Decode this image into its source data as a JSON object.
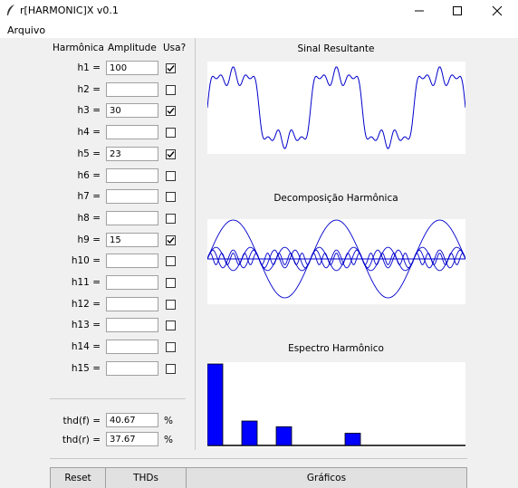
{
  "window": {
    "title": "r[HARMONIC]X v0.1"
  },
  "menu": {
    "file_label": "Arquivo"
  },
  "table": {
    "col_harmonic": "Harmônica",
    "col_amplitude": "Amplitude",
    "col_use": "Usa?",
    "rows": [
      {
        "label": "h1 =",
        "value": "100",
        "checked": true
      },
      {
        "label": "h2 =",
        "value": "",
        "checked": false
      },
      {
        "label": "h3 =",
        "value": "30",
        "checked": true
      },
      {
        "label": "h4 =",
        "value": "",
        "checked": false
      },
      {
        "label": "h5 =",
        "value": "23",
        "checked": true
      },
      {
        "label": "h6 =",
        "value": "",
        "checked": false
      },
      {
        "label": "h7 =",
        "value": "",
        "checked": false
      },
      {
        "label": "h8 =",
        "value": "",
        "checked": false
      },
      {
        "label": "h9 =",
        "value": "15",
        "checked": true
      },
      {
        "label": "h10 =",
        "value": "",
        "checked": false
      },
      {
        "label": "h11 =",
        "value": "",
        "checked": false
      },
      {
        "label": "h12 =",
        "value": "",
        "checked": false
      },
      {
        "label": "h13 =",
        "value": "",
        "checked": false
      },
      {
        "label": "h14 =",
        "value": "",
        "checked": false
      },
      {
        "label": "h15 =",
        "value": "",
        "checked": false
      }
    ]
  },
  "thd": {
    "f_label": "thd(f) =",
    "f_value": "40.67",
    "f_unit": "%",
    "r_label": "thd(r) =",
    "r_value": "37.67",
    "r_unit": "%"
  },
  "plots": {
    "signal_title": "Sinal Resultante",
    "decomp_title": "Decomposição Harmônica",
    "spectrum_title": "Espectro Harmônico"
  },
  "buttons": {
    "reset": "Reset",
    "thds": "THDs",
    "graphs": "Gráficos"
  },
  "colors": {
    "wave": "#0000cc",
    "spectrum_bar": "#0000ff",
    "baseline": "#000000"
  },
  "chart_data": {
    "type": "bar",
    "categories": [
      "h1",
      "h2",
      "h3",
      "h4",
      "h5",
      "h6",
      "h7",
      "h8",
      "h9",
      "h10",
      "h11",
      "h12",
      "h13",
      "h14",
      "h15"
    ],
    "values": [
      100,
      0,
      30,
      0,
      23,
      0,
      0,
      0,
      15,
      0,
      0,
      0,
      0,
      0,
      0
    ],
    "title": "Espectro Harmônico"
  }
}
